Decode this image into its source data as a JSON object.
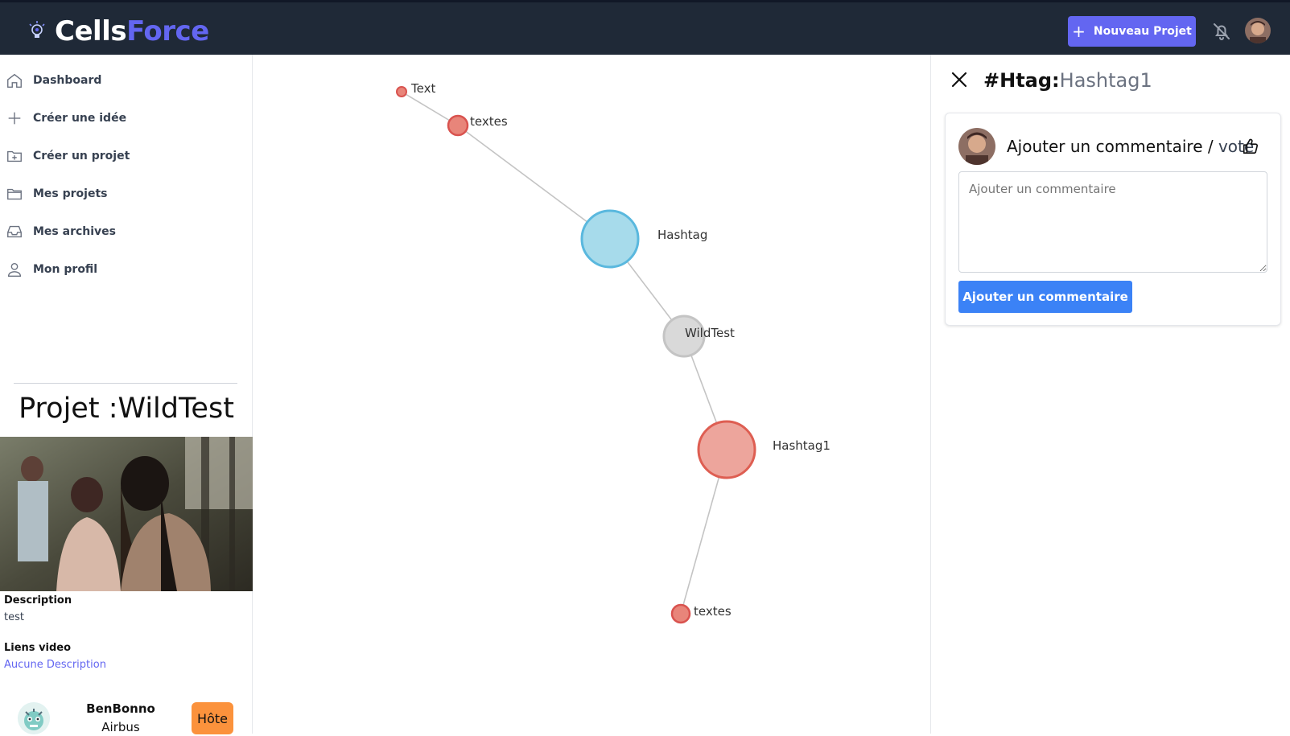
{
  "header": {
    "logo_part1": "Cells",
    "logo_part2": "Force",
    "new_project_label": "Nouveau Projet",
    "accent_color": "#6366f1",
    "bar_color": "#1f2937"
  },
  "sidebar": {
    "items": [
      {
        "label": "Dashboard",
        "icon": "home-icon"
      },
      {
        "label": "Créer une idée",
        "icon": "plus-icon"
      },
      {
        "label": "Créer un projet",
        "icon": "folder-plus-icon"
      },
      {
        "label": "Mes projets",
        "icon": "folder-icon"
      },
      {
        "label": "Mes archives",
        "icon": "inbox-icon"
      },
      {
        "label": "Mon profil",
        "icon": "user-icon"
      }
    ],
    "project": {
      "title_prefix": "Projet :",
      "title_name": "WildTest",
      "description_label": "Description",
      "description_value": "test",
      "video_label": "Liens video",
      "video_value": "Aucune Description",
      "user_name": "BenBonno",
      "user_org": "Airbus",
      "user_role": "Hôte"
    }
  },
  "graph": {
    "nodes": [
      {
        "id": "n1",
        "label": "Text",
        "color": "#e05d50",
        "size": "tiny"
      },
      {
        "id": "n2",
        "label": "textes",
        "color": "#e05d50",
        "size": "small"
      },
      {
        "id": "n3",
        "label": "Hashtag",
        "color": "#56b4d9",
        "size": "large"
      },
      {
        "id": "n4",
        "label": "WildTest",
        "color": "#c8c8c8",
        "size": "medium"
      },
      {
        "id": "n5",
        "label": "Hashtag1",
        "color": "#e05d50",
        "size": "large"
      },
      {
        "id": "n6",
        "label": "textes",
        "color": "#e05d50",
        "size": "small"
      }
    ],
    "edges": [
      [
        "n1",
        "n2"
      ],
      [
        "n2",
        "n3"
      ],
      [
        "n3",
        "n4"
      ],
      [
        "n4",
        "n5"
      ],
      [
        "n5",
        "n6"
      ]
    ]
  },
  "panel": {
    "title_tag": "#Htag:",
    "title_name": "Hashtag1",
    "comment_heading": "Ajouter un commentaire / ",
    "vote_label": "vote",
    "textarea_placeholder": "Ajouter un commentaire",
    "submit_label": "Ajouter un commentaire"
  }
}
